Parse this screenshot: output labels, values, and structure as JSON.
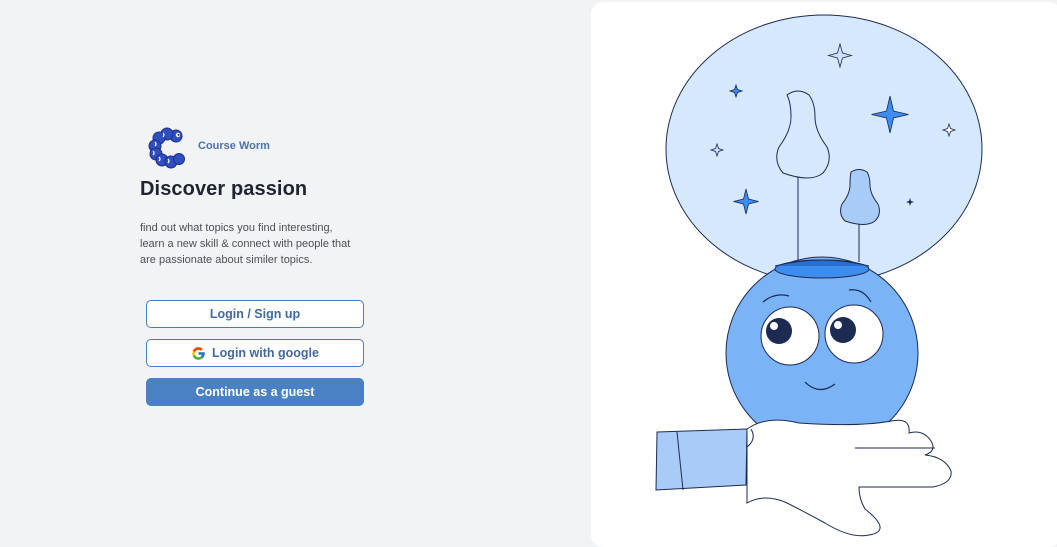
{
  "brand": {
    "name": "Course Worm",
    "logo_icon": "worm-logo-icon",
    "color": "#4b72b0"
  },
  "hero": {
    "title": "Discover passion",
    "description_lines": [
      "find out what topics you find interesting,",
      "learn a new skill & connect with people that",
      "are passionate about similer topics."
    ]
  },
  "actions": {
    "login_signup_label": "Login / Sign up",
    "google_label": "Login with google",
    "google_icon": "google-icon",
    "guest_label": "Continue as a guest"
  },
  "illustration": {
    "name": "idea-bulb-character-illustration",
    "accent": "#3d8cf0",
    "light": "#d6e8fd",
    "mid": "#7ab4f7"
  },
  "colors": {
    "background": "#f2f3f4",
    "panel": "#ffffff",
    "primary": "#4a80c4",
    "text": "#1f2530"
  }
}
